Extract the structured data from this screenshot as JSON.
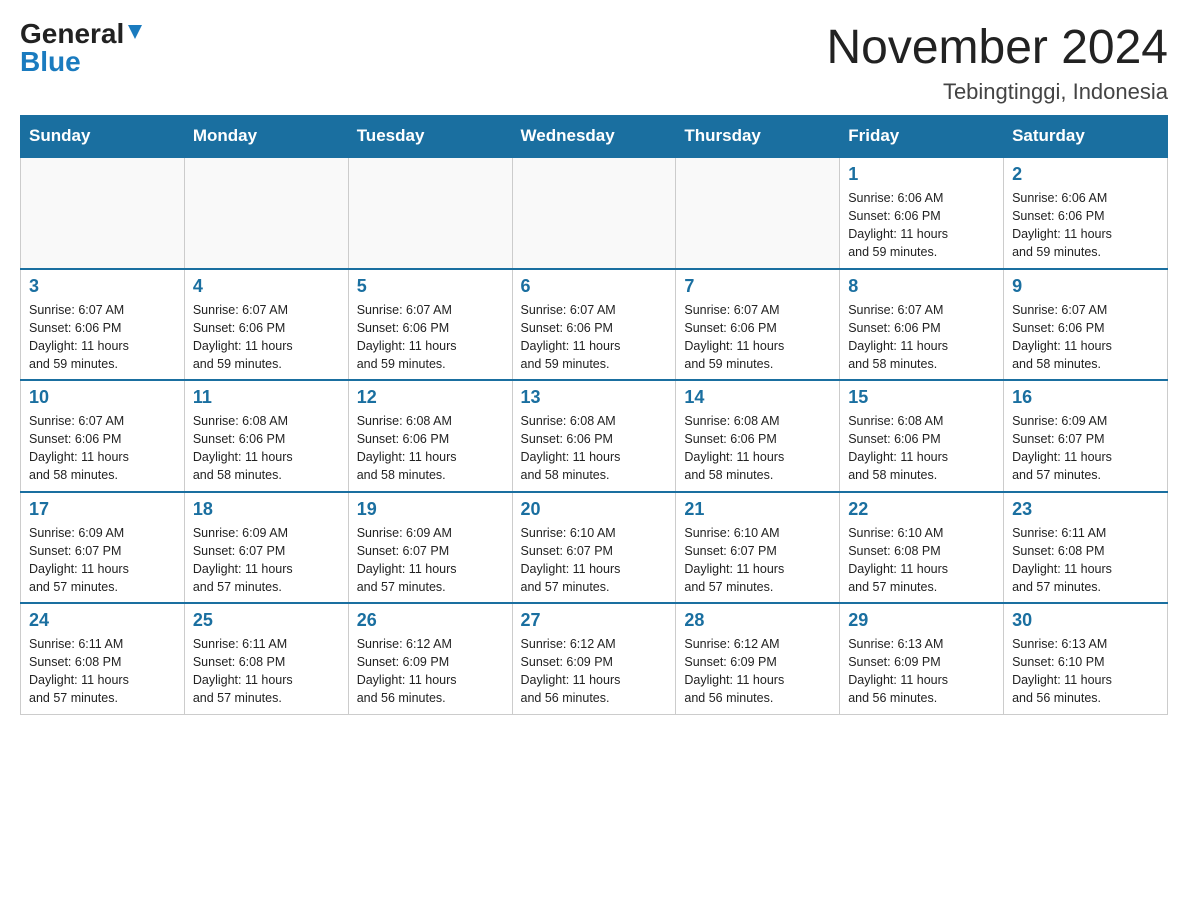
{
  "header": {
    "logo_general": "General",
    "logo_blue": "Blue",
    "month_title": "November 2024",
    "location": "Tebingtinggi, Indonesia"
  },
  "days_of_week": [
    "Sunday",
    "Monday",
    "Tuesday",
    "Wednesday",
    "Thursday",
    "Friday",
    "Saturday"
  ],
  "weeks": [
    [
      {
        "day": "",
        "info": ""
      },
      {
        "day": "",
        "info": ""
      },
      {
        "day": "",
        "info": ""
      },
      {
        "day": "",
        "info": ""
      },
      {
        "day": "",
        "info": ""
      },
      {
        "day": "1",
        "info": "Sunrise: 6:06 AM\nSunset: 6:06 PM\nDaylight: 11 hours\nand 59 minutes."
      },
      {
        "day": "2",
        "info": "Sunrise: 6:06 AM\nSunset: 6:06 PM\nDaylight: 11 hours\nand 59 minutes."
      }
    ],
    [
      {
        "day": "3",
        "info": "Sunrise: 6:07 AM\nSunset: 6:06 PM\nDaylight: 11 hours\nand 59 minutes."
      },
      {
        "day": "4",
        "info": "Sunrise: 6:07 AM\nSunset: 6:06 PM\nDaylight: 11 hours\nand 59 minutes."
      },
      {
        "day": "5",
        "info": "Sunrise: 6:07 AM\nSunset: 6:06 PM\nDaylight: 11 hours\nand 59 minutes."
      },
      {
        "day": "6",
        "info": "Sunrise: 6:07 AM\nSunset: 6:06 PM\nDaylight: 11 hours\nand 59 minutes."
      },
      {
        "day": "7",
        "info": "Sunrise: 6:07 AM\nSunset: 6:06 PM\nDaylight: 11 hours\nand 59 minutes."
      },
      {
        "day": "8",
        "info": "Sunrise: 6:07 AM\nSunset: 6:06 PM\nDaylight: 11 hours\nand 58 minutes."
      },
      {
        "day": "9",
        "info": "Sunrise: 6:07 AM\nSunset: 6:06 PM\nDaylight: 11 hours\nand 58 minutes."
      }
    ],
    [
      {
        "day": "10",
        "info": "Sunrise: 6:07 AM\nSunset: 6:06 PM\nDaylight: 11 hours\nand 58 minutes."
      },
      {
        "day": "11",
        "info": "Sunrise: 6:08 AM\nSunset: 6:06 PM\nDaylight: 11 hours\nand 58 minutes."
      },
      {
        "day": "12",
        "info": "Sunrise: 6:08 AM\nSunset: 6:06 PM\nDaylight: 11 hours\nand 58 minutes."
      },
      {
        "day": "13",
        "info": "Sunrise: 6:08 AM\nSunset: 6:06 PM\nDaylight: 11 hours\nand 58 minutes."
      },
      {
        "day": "14",
        "info": "Sunrise: 6:08 AM\nSunset: 6:06 PM\nDaylight: 11 hours\nand 58 minutes."
      },
      {
        "day": "15",
        "info": "Sunrise: 6:08 AM\nSunset: 6:06 PM\nDaylight: 11 hours\nand 58 minutes."
      },
      {
        "day": "16",
        "info": "Sunrise: 6:09 AM\nSunset: 6:07 PM\nDaylight: 11 hours\nand 57 minutes."
      }
    ],
    [
      {
        "day": "17",
        "info": "Sunrise: 6:09 AM\nSunset: 6:07 PM\nDaylight: 11 hours\nand 57 minutes."
      },
      {
        "day": "18",
        "info": "Sunrise: 6:09 AM\nSunset: 6:07 PM\nDaylight: 11 hours\nand 57 minutes."
      },
      {
        "day": "19",
        "info": "Sunrise: 6:09 AM\nSunset: 6:07 PM\nDaylight: 11 hours\nand 57 minutes."
      },
      {
        "day": "20",
        "info": "Sunrise: 6:10 AM\nSunset: 6:07 PM\nDaylight: 11 hours\nand 57 minutes."
      },
      {
        "day": "21",
        "info": "Sunrise: 6:10 AM\nSunset: 6:07 PM\nDaylight: 11 hours\nand 57 minutes."
      },
      {
        "day": "22",
        "info": "Sunrise: 6:10 AM\nSunset: 6:08 PM\nDaylight: 11 hours\nand 57 minutes."
      },
      {
        "day": "23",
        "info": "Sunrise: 6:11 AM\nSunset: 6:08 PM\nDaylight: 11 hours\nand 57 minutes."
      }
    ],
    [
      {
        "day": "24",
        "info": "Sunrise: 6:11 AM\nSunset: 6:08 PM\nDaylight: 11 hours\nand 57 minutes."
      },
      {
        "day": "25",
        "info": "Sunrise: 6:11 AM\nSunset: 6:08 PM\nDaylight: 11 hours\nand 57 minutes."
      },
      {
        "day": "26",
        "info": "Sunrise: 6:12 AM\nSunset: 6:09 PM\nDaylight: 11 hours\nand 56 minutes."
      },
      {
        "day": "27",
        "info": "Sunrise: 6:12 AM\nSunset: 6:09 PM\nDaylight: 11 hours\nand 56 minutes."
      },
      {
        "day": "28",
        "info": "Sunrise: 6:12 AM\nSunset: 6:09 PM\nDaylight: 11 hours\nand 56 minutes."
      },
      {
        "day": "29",
        "info": "Sunrise: 6:13 AM\nSunset: 6:09 PM\nDaylight: 11 hours\nand 56 minutes."
      },
      {
        "day": "30",
        "info": "Sunrise: 6:13 AM\nSunset: 6:10 PM\nDaylight: 11 hours\nand 56 minutes."
      }
    ]
  ]
}
